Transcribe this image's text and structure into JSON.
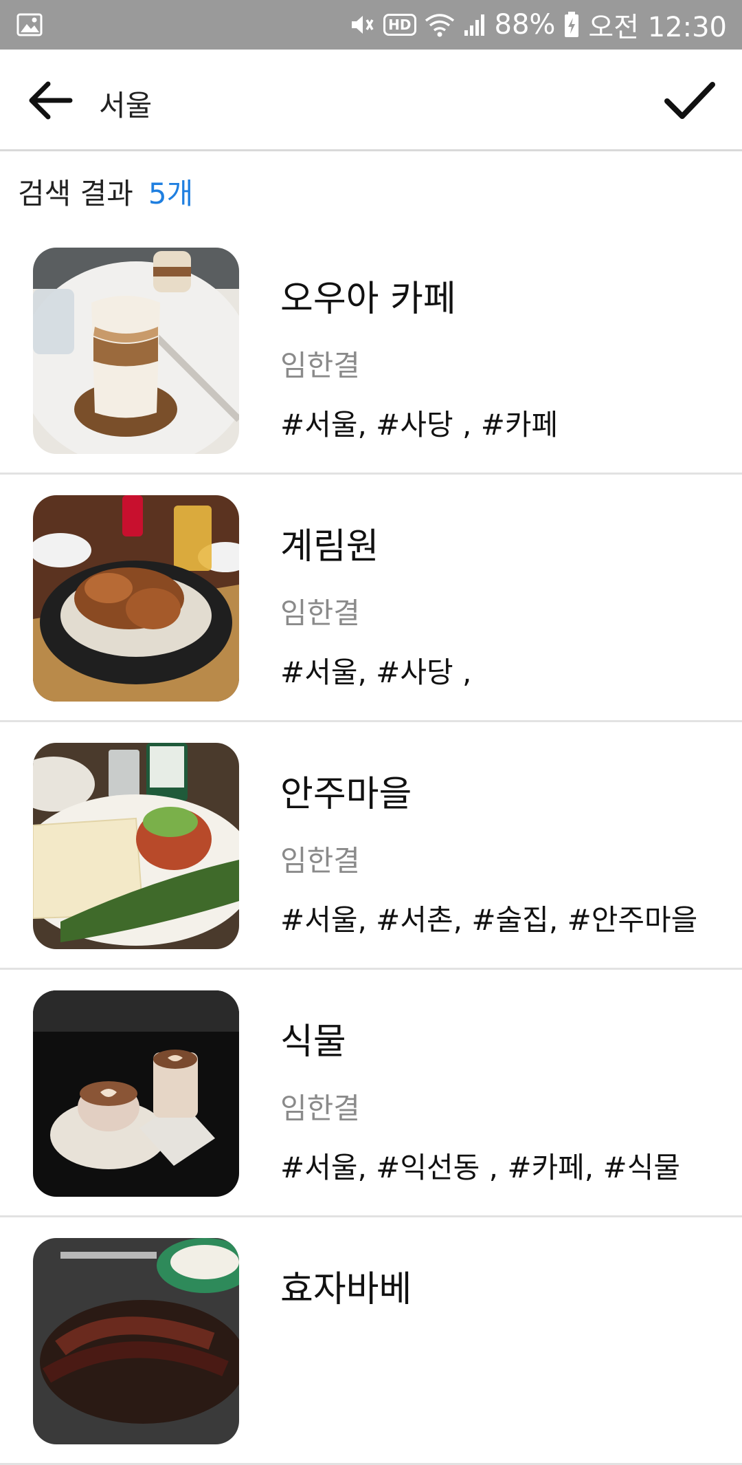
{
  "status_bar": {
    "battery": "88%",
    "time": "오전 12:30",
    "hd_label": "HD",
    "icons": [
      "image-icon",
      "mute-icon",
      "hd-icon",
      "wifi-icon",
      "signal-icon",
      "battery-charging-icon"
    ]
  },
  "header": {
    "search_query": "서울",
    "back_icon": "arrow-left-icon",
    "confirm_icon": "check-icon"
  },
  "results": {
    "label": "검색 결과",
    "count": "5개"
  },
  "items": [
    {
      "title": "오우아 카페",
      "author": "임한결",
      "tags": "#서울, #사당 , #카페"
    },
    {
      "title": "계림원",
      "author": "임한결",
      "tags": "#서울, #사당 ,"
    },
    {
      "title": "안주마을",
      "author": "임한결",
      "tags": "#서울, #서촌, #술집, #안주마을"
    },
    {
      "title": "식물",
      "author": "임한결",
      "tags": "#서울, #익선동 , #카페, #식물"
    },
    {
      "title": "효자바베",
      "author": "",
      "tags": ""
    }
  ],
  "colors": {
    "accent": "#1f7fe0",
    "status_bar": "#9a9a9a",
    "divider": "#e2e2e2"
  }
}
